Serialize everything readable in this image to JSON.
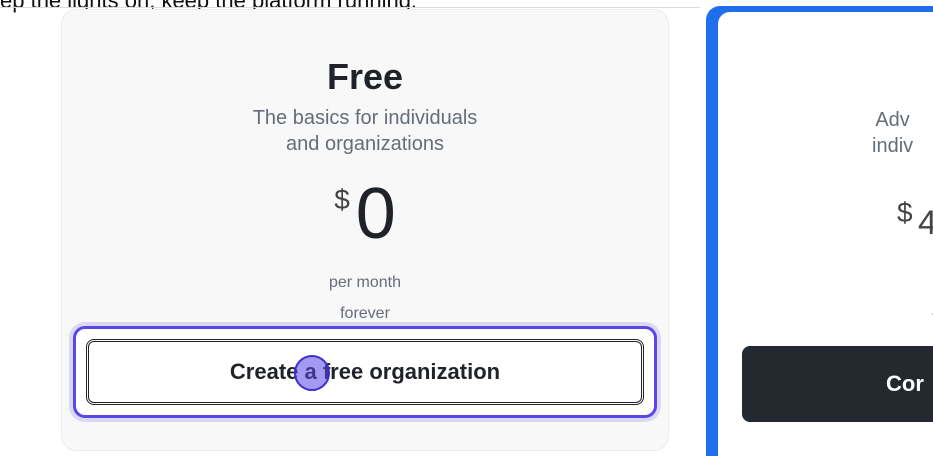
{
  "top_text": "ep the lights on, keep the platform running.",
  "plans": [
    {
      "title": "Free",
      "description_lines": [
        "The basics for individuals",
        "and organizations"
      ],
      "currency": "$",
      "price": "0",
      "period_lines": [
        "per month",
        "forever"
      ],
      "cta_label": "Create a free organization"
    },
    {
      "description_lines": [
        "Adv",
        "indiv"
      ],
      "currency": "$",
      "price_partial": "4",
      "period_partial": "f",
      "cta_label_partial": "Cor"
    }
  ],
  "colors": {
    "focus_ring": "#5b47e6",
    "team_card_border": "#1f6feb",
    "team_cta_bg": "#24292f"
  }
}
